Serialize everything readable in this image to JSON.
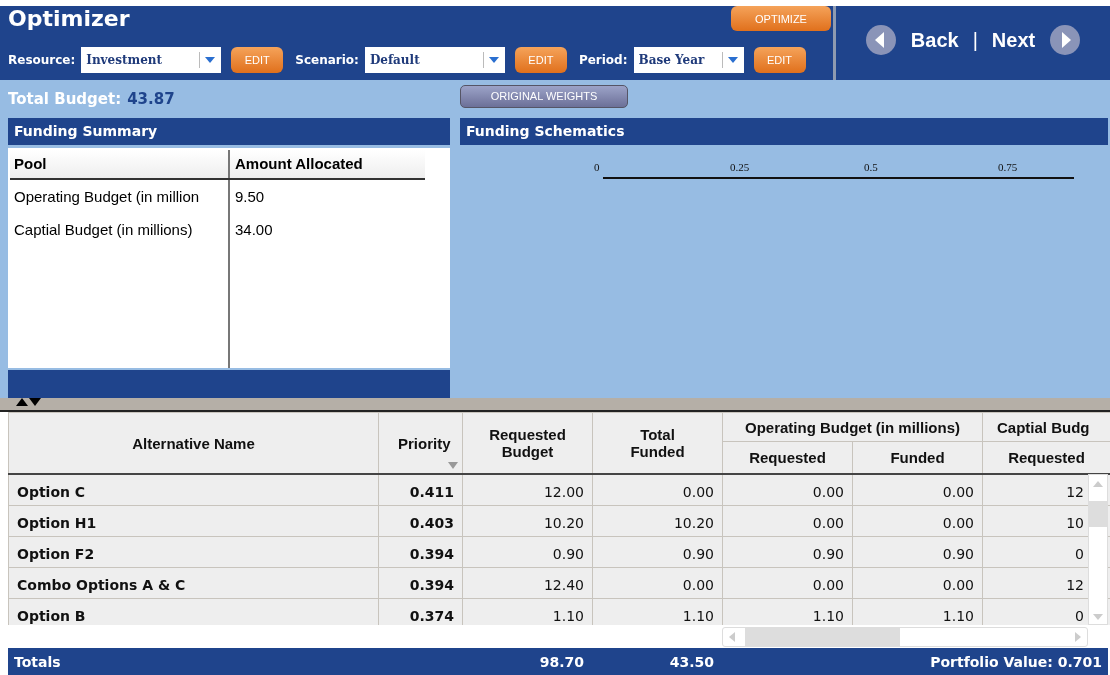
{
  "app": {
    "title": "Optimizer",
    "optimize_button": "OPTIMIZE"
  },
  "selectors": [
    {
      "label": "Resource:",
      "value": "Investment",
      "button": "EDIT"
    },
    {
      "label": "Scenario:",
      "value": "Default",
      "button": "EDIT"
    },
    {
      "label": "Period:",
      "value": "Base Year",
      "button": "EDIT"
    }
  ],
  "nav": {
    "back": "Back",
    "separator": "|",
    "next": "Next"
  },
  "total_budget": {
    "label": "Total Budget:",
    "value": "43.87"
  },
  "original_weights_button": "ORIGINAL WEIGHTS",
  "funding_summary": {
    "title": "Funding Summary",
    "columns": [
      "Pool",
      "Amount Allocated"
    ],
    "rows": [
      [
        "Operating Budget (in million",
        "9.50"
      ],
      [
        "Captial Budget (in millions)",
        "34.00"
      ]
    ]
  },
  "funding_schematics": {
    "title": "Funding Schematics",
    "axis_ticks": [
      "0",
      "0.25",
      "0.5",
      "0.75"
    ]
  },
  "alternatives_table": {
    "columns": [
      {
        "label": "Alternative Name",
        "sortable": false
      },
      {
        "label": "Priority",
        "sortable": true
      },
      {
        "label": "Requested Budget",
        "sortable": false
      },
      {
        "label": "Total Funded",
        "sortable": false
      }
    ],
    "groups": [
      {
        "label": "Operating Budget (in millions)",
        "columns": [
          "Requested",
          "Funded"
        ]
      },
      {
        "label": "Captial Budg",
        "columns": [
          "Requested"
        ]
      }
    ],
    "rows": [
      [
        "Option C",
        "0.411",
        "12.00",
        "0.00",
        "0.00",
        "0.00",
        "12"
      ],
      [
        "Option H1",
        "0.403",
        "10.20",
        "10.20",
        "0.00",
        "0.00",
        "10"
      ],
      [
        "Option F2",
        "0.394",
        "0.90",
        "0.90",
        "0.90",
        "0.90",
        "0"
      ],
      [
        "Combo Options A & C",
        "0.394",
        "12.40",
        "0.00",
        "0.00",
        "0.00",
        "12"
      ],
      [
        "Option B",
        "0.374",
        "1.10",
        "1.10",
        "1.10",
        "1.10",
        "0"
      ]
    ]
  },
  "totals": {
    "label": "Totals",
    "requested_budget": "98.70",
    "total_funded": "43.50",
    "portfolio_value": "Portfolio Value: 0.701"
  }
}
